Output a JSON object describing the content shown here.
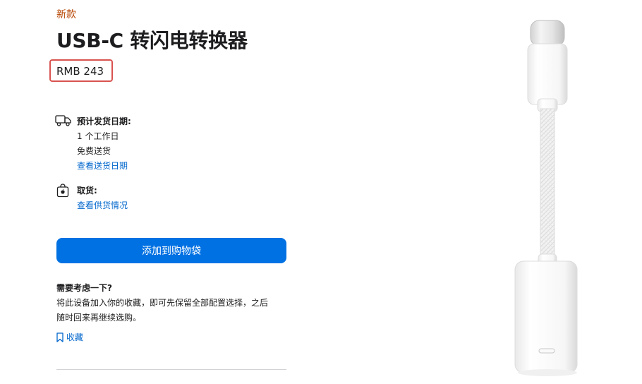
{
  "product": {
    "badge": "新款",
    "title": "USB-C 转闪电转换器",
    "price": "RMB 243"
  },
  "shipping": {
    "heading": "预计发货日期:",
    "line1": "1 个工作日",
    "line2": "免费送货",
    "link": "查看送货日期"
  },
  "pickup": {
    "heading": "取货:",
    "link": "查看供货情况"
  },
  "cta": {
    "label": "添加到购物袋"
  },
  "consider": {
    "heading": "需要考虑一下?",
    "line1": "将此设备加入你的收藏，即可先保留全部配置选择，之后",
    "line2": "随时回来再继续选购。",
    "save_label": "收藏"
  },
  "colors": {
    "accent": "#0071e3",
    "link": "#0066cc",
    "badge": "#b64400",
    "highlight": "#d9534f"
  },
  "icons": {
    "shipping": "truck-icon",
    "pickup": "apple-bag-icon",
    "save": "bookmark-icon"
  }
}
